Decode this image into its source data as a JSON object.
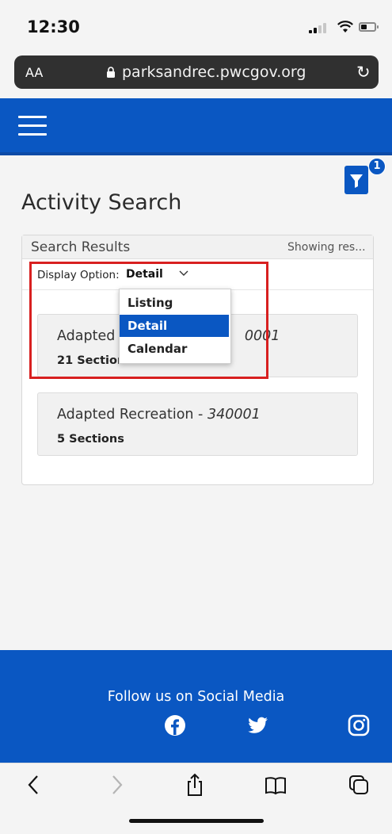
{
  "status_bar": {
    "time": "12:30"
  },
  "browser": {
    "text_size_label": "AA",
    "url": "parksandrec.pwcgov.org",
    "reload_glyph": "↻"
  },
  "header": {
    "filter_count": "1"
  },
  "page": {
    "title": "Activity Search"
  },
  "results": {
    "heading": "Search Results",
    "showing_text": "Showing res...",
    "display_option_label": "Display Option:",
    "display_option_value": "Detail",
    "display_options": [
      "Listing",
      "Detail",
      "Calendar"
    ],
    "items": [
      {
        "name": "Adapted ",
        "code": "0001",
        "sections": "21 Sections"
      },
      {
        "name": "Adapted Recreation - ",
        "code": "340001",
        "sections": "5 Sections"
      }
    ]
  },
  "footer": {
    "follow_text": "Follow us on Social Media"
  },
  "colors": {
    "brand_blue": "#0a57c2",
    "highlight_red": "#d82020"
  }
}
